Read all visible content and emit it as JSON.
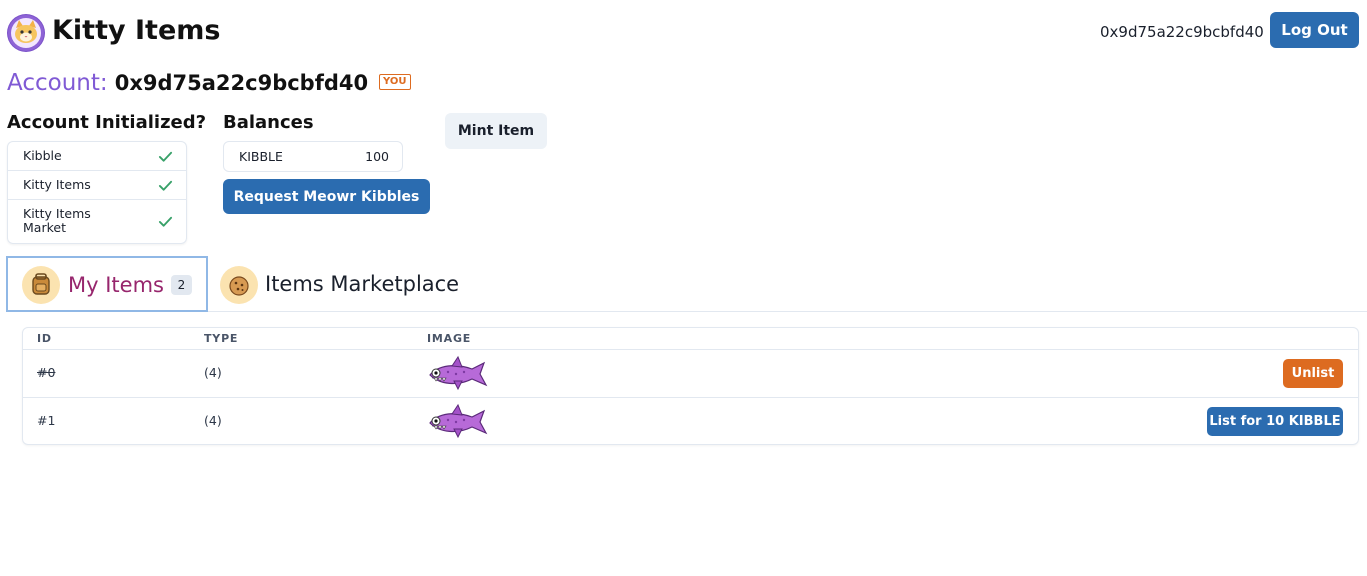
{
  "header": {
    "logo_icon": "kitty-logo-icon",
    "title": "Kitty Items",
    "address": "0x9d75a22c9bcbfd40",
    "logout_label": "Log Out"
  },
  "account": {
    "label": "Account:",
    "address": "0x9d75a22c9bcbfd40",
    "badge": "YOU"
  },
  "initialization": {
    "heading": "Account Initialized?",
    "items": [
      {
        "label": "Kibble",
        "status": "check-icon"
      },
      {
        "label": "Kitty Items",
        "status": "check-icon"
      },
      {
        "label": "Kitty Items Market",
        "status": "check-icon"
      }
    ]
  },
  "balances": {
    "heading": "Balances",
    "token": "KIBBLE",
    "amount": "100",
    "request_label": "Request Meowr Kibbles"
  },
  "mint": {
    "label": "Mint Item"
  },
  "tabs": [
    {
      "label": "My Items",
      "count": "2",
      "icon": "backpack-icon",
      "active": true
    },
    {
      "label": "Items Marketplace",
      "icon": "cookie-icon",
      "active": false
    }
  ],
  "table": {
    "columns": [
      "ID",
      "TYPE",
      "IMAGE"
    ],
    "rows": [
      {
        "id": "#0",
        "type": "(4)",
        "image": "shark-image",
        "action": "Unlist",
        "id_struck": true
      },
      {
        "id": "#1",
        "type": "(4)",
        "image": "shark-image",
        "action": "List for 10 KIBBLE",
        "id_struck": false
      }
    ]
  },
  "colors": {
    "primary": "#2b6cb0",
    "accent_purple": "#805ad5",
    "active_tab_text": "#97266d",
    "unlist": "#dd6b20",
    "check": "#38a169"
  }
}
